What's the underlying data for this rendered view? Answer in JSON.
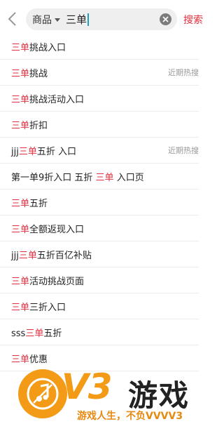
{
  "header": {
    "scope_label": "商品",
    "query": "三单",
    "search_label": "搜索"
  },
  "suggestions": [
    {
      "pre": "",
      "hl": "三单",
      "post": "挑战入口",
      "tag": ""
    },
    {
      "pre": "",
      "hl": "三单",
      "post": "挑战",
      "tag": "近期热搜"
    },
    {
      "pre": "",
      "hl": "三单",
      "post": "挑战活动入口",
      "tag": ""
    },
    {
      "pre": "",
      "hl": "三单",
      "post": "折扣",
      "tag": ""
    },
    {
      "pre": "jjj",
      "hl": "三单",
      "post": "五折 入口",
      "tag": "近期热搜"
    },
    {
      "pre": "第一单9折入口 五折 ",
      "hl": "三单",
      "post": " 入口页",
      "tag": ""
    },
    {
      "pre": "",
      "hl": "三单",
      "post": "五折",
      "tag": ""
    },
    {
      "pre": "",
      "hl": "三单",
      "post": "全额返现入口",
      "tag": ""
    },
    {
      "pre": "jjj",
      "hl": "三单",
      "post": "五折百亿补贴",
      "tag": ""
    },
    {
      "pre": "",
      "hl": "三单",
      "post": "活动挑战页面",
      "tag": ""
    },
    {
      "pre": "",
      "hl": "三单",
      "post": "三折入口",
      "tag": ""
    },
    {
      "pre": "sss",
      "hl": "三单",
      "post": "五折",
      "tag": ""
    },
    {
      "pre": "",
      "hl": "三单",
      "post": "优惠",
      "tag": ""
    }
  ],
  "watermark": {
    "brand": "V3",
    "game": "游戏",
    "slogan": "游戏人生，不负VVVV3"
  },
  "colors": {
    "highlight": "#e0303f",
    "brand_orange": "#f39a16"
  }
}
